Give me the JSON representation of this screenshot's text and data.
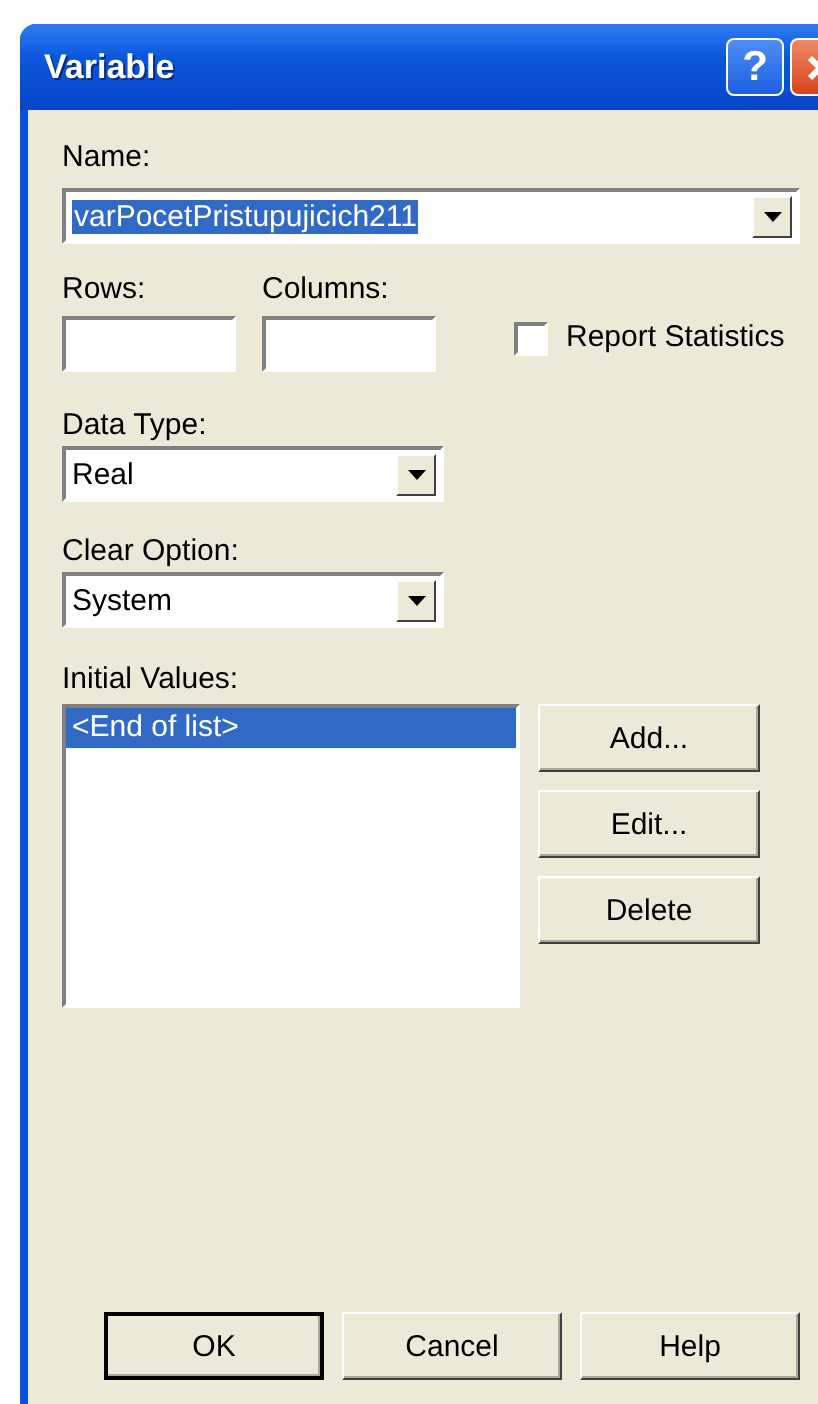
{
  "window": {
    "title": "Variable",
    "help_button": "?"
  },
  "name": {
    "label": "Name:",
    "value": "varPocetPristupujicich211",
    "value_selected": true
  },
  "rows": {
    "label": "Rows:"
  },
  "columns": {
    "label": "Columns:"
  },
  "report_statistics": {
    "label": "Report Statistics",
    "checked": false
  },
  "data_type": {
    "label": "Data Type:",
    "value": "Real"
  },
  "clear_option": {
    "label": "Clear Option:",
    "value": "System"
  },
  "initial_values": {
    "label": "Initial Values:",
    "items": [
      {
        "text": "<End of list>",
        "selected": true
      }
    ]
  },
  "side_buttons": [
    "Add...",
    "Edit...",
    "Delete"
  ],
  "buttons": [
    {
      "label": "OK",
      "default": true
    },
    {
      "label": "Cancel",
      "default": false
    },
    {
      "label": "Help",
      "default": false
    }
  ]
}
